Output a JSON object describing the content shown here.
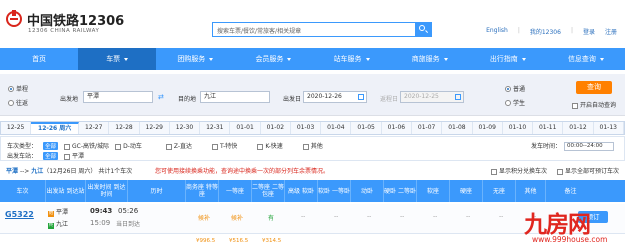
{
  "header": {
    "logo_cn": "中国铁路12306",
    "logo_en": "12306 CHINA RAILWAY",
    "search_placeholder": "搜索车票/餐饮/常旅客/相关规章",
    "links": [
      "English",
      "我的12306",
      "登录",
      "注册"
    ]
  },
  "nav": {
    "items": [
      "首页",
      "车票",
      "团购服务",
      "会员服务",
      "站车服务",
      "商旅服务",
      "出行指南",
      "信息查询"
    ],
    "active_index": 1
  },
  "query": {
    "trip_types": [
      "单程",
      "往返"
    ],
    "trip_selected": 0,
    "from_label": "出发地",
    "from_value": "平潭",
    "to_label": "目的地",
    "to_value": "九江",
    "depart_label": "出发日",
    "depart_value": "2020-12-26",
    "return_label": "返程日",
    "return_value": "2020-12-25",
    "passenger_types": [
      "普通",
      "学生"
    ],
    "passenger_selected": 0,
    "query_button": "查询",
    "auto_query_label": "开启自动查询"
  },
  "date_tabs": [
    "12-25",
    "12-26 周六",
    "12-27",
    "12-28",
    "12-29",
    "12-30",
    "12-31",
    "01-01",
    "01-02",
    "01-03",
    "01-04",
    "01-05",
    "01-06",
    "01-07",
    "01-08",
    "01-09",
    "01-10",
    "01-11",
    "01-12",
    "01-13"
  ],
  "date_tab_active": 1,
  "filters": {
    "type_label": "车次类型：",
    "all_tag": "全部",
    "types": [
      "GC-高铁/城际",
      "D-动车",
      "Z-直达",
      "T-特快",
      "K-快速",
      "其他"
    ],
    "station_label": "出发车站：",
    "stations": [
      "平潭"
    ],
    "time_label": "发车时间：",
    "time_value": "00:00--24:00"
  },
  "infobar": {
    "route_from": "平潭",
    "route_arrow": "-->",
    "route_to": "九江",
    "route_date": "（12月26日 周六）",
    "count": "共计1个车次",
    "note": "您可使用接续换乘功能，查询途中换乘一次的部分列车余票情况。",
    "right_options": [
      "显示积分兑换车次",
      "显示全部可预订车次"
    ]
  },
  "table": {
    "headers": [
      "车次",
      "出发站 到达站",
      "出发时间 到达时间",
      "历时",
      "商务座 特等座",
      "一等座",
      "二等座 二等包座",
      "高级 软卧",
      "软卧 一等卧",
      "动卧",
      "硬卧 二等卧",
      "软座",
      "硬座",
      "无座",
      "其他",
      "备注"
    ],
    "rows": [
      {
        "train": "G5322",
        "from_station": "平潭",
        "to_station": "九江",
        "depart": "09:43",
        "arrive": "15:09",
        "duration": "05:26",
        "duration_note": "当日到达",
        "business": "候补",
        "first": "候补",
        "second": "有",
        "others": [
          "--",
          "--",
          "--",
          "--",
          "--",
          "--",
          "--",
          "--"
        ],
        "action": "预订",
        "prices": [
          "¥996.5",
          "¥516.5",
          "¥314.5"
        ]
      }
    ]
  },
  "watermark": {
    "logo_text": "九房网",
    "url": "www.999house.com"
  }
}
